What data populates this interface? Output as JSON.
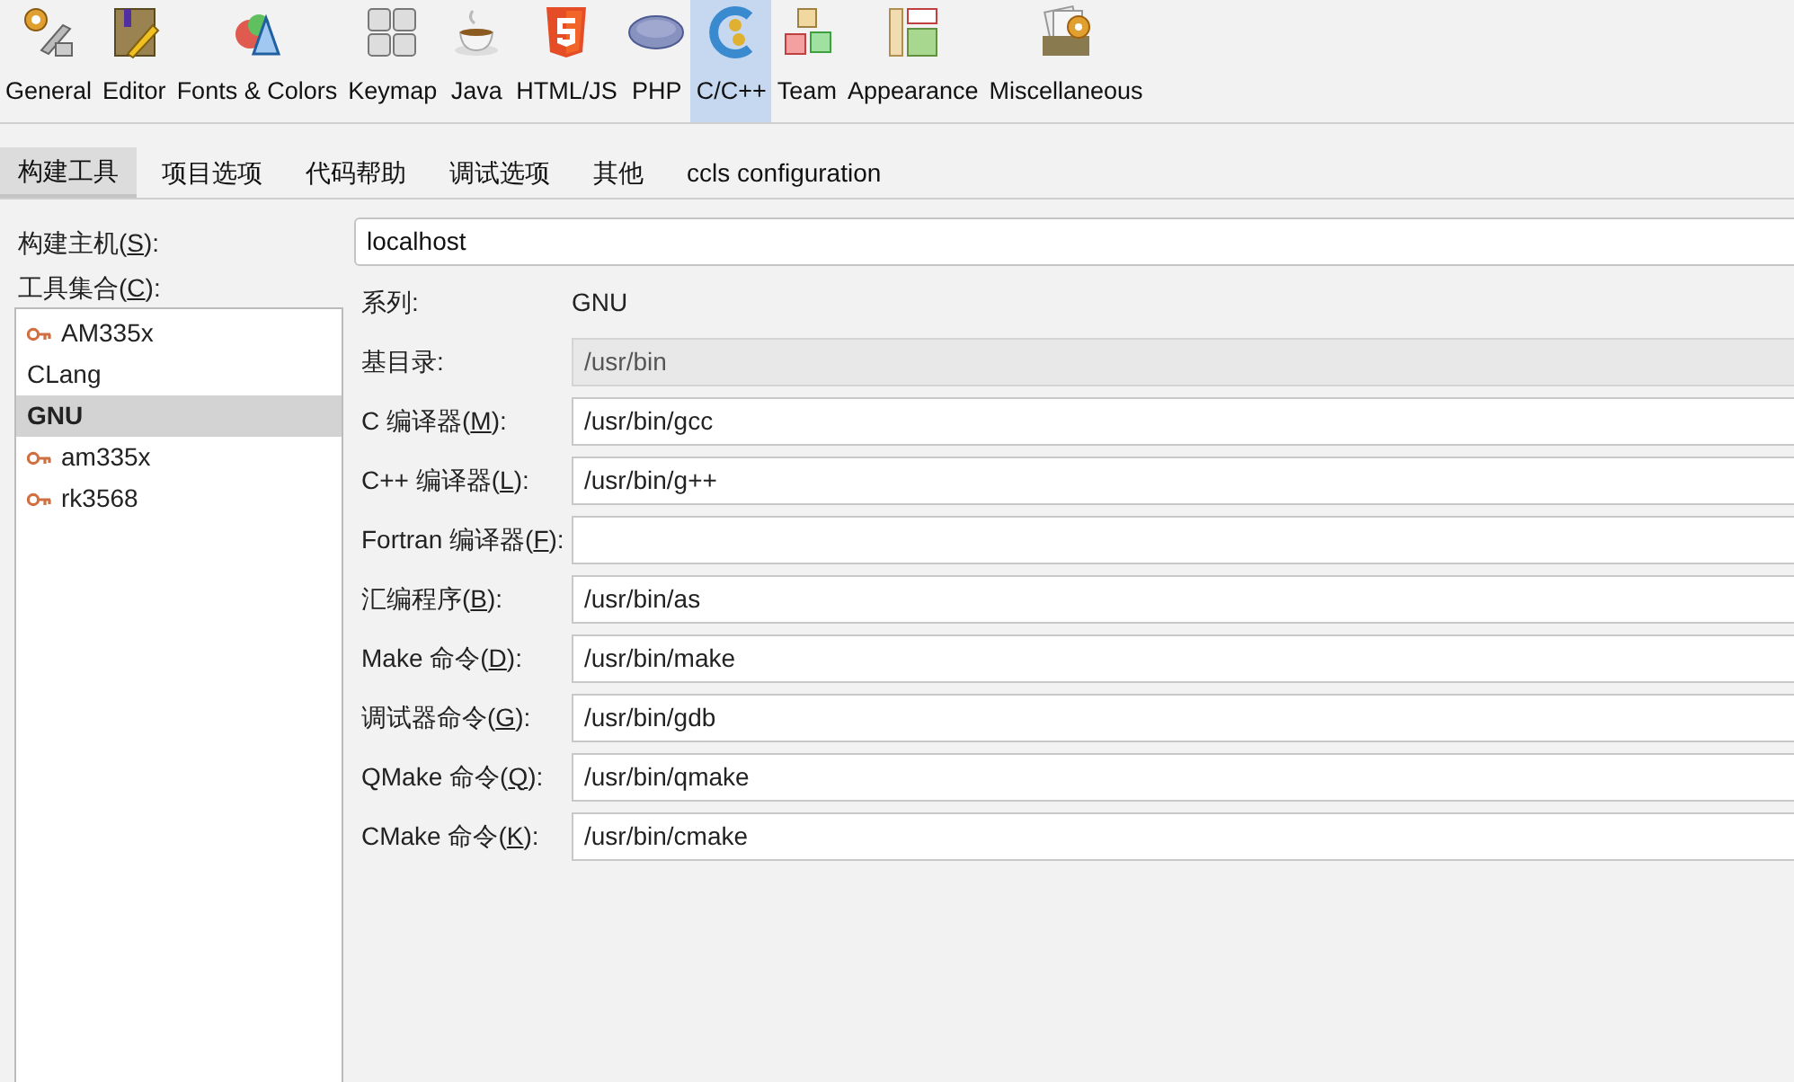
{
  "categories": [
    {
      "label": "General",
      "selected": false
    },
    {
      "label": "Editor",
      "selected": false
    },
    {
      "label": "Fonts & Colors",
      "selected": false
    },
    {
      "label": "Keymap",
      "selected": false
    },
    {
      "label": "Java",
      "selected": false
    },
    {
      "label": "HTML/JS",
      "selected": false
    },
    {
      "label": "PHP",
      "selected": false
    },
    {
      "label": "C/C++",
      "selected": true
    },
    {
      "label": "Team",
      "selected": false
    },
    {
      "label": "Appearance",
      "selected": false
    },
    {
      "label": "Miscellaneous",
      "selected": false
    }
  ],
  "tabs": [
    {
      "label": "构建工具",
      "selected": true
    },
    {
      "label": "项目选项",
      "selected": false
    },
    {
      "label": "代码帮助",
      "selected": false
    },
    {
      "label": "调试选项",
      "selected": false
    },
    {
      "label": "其他",
      "selected": false
    },
    {
      "label": "ccls configuration",
      "selected": false
    }
  ],
  "build_host": {
    "label_start": "构建主机(",
    "mnemonic": "S",
    "label_end": "):",
    "value": "localhost"
  },
  "tool_collection": {
    "label_start": "工具集合(",
    "mnemonic": "C",
    "label_end": "):",
    "items": [
      {
        "label": "AM335x",
        "remote": true,
        "selected": false
      },
      {
        "label": "CLang",
        "remote": false,
        "selected": false
      },
      {
        "label": "GNU",
        "remote": false,
        "selected": true
      },
      {
        "label": "am335x",
        "remote": true,
        "selected": false
      },
      {
        "label": "rk3568",
        "remote": true,
        "selected": false
      }
    ]
  },
  "family": {
    "label": "系列:",
    "value": "GNU"
  },
  "fields": [
    {
      "label_start": "基目录:",
      "value": "/usr/bin",
      "disabled": true
    },
    {
      "label_start": "C 编译器(",
      "mnemonic": "M",
      "label_end": "):",
      "value": "/usr/bin/gcc",
      "disabled": false
    },
    {
      "label_start": "C++ 编译器(",
      "mnemonic": "L",
      "label_end": "):",
      "value": "/usr/bin/g++",
      "disabled": false
    },
    {
      "label_start": "Fortran 编译器(",
      "mnemonic": "F",
      "label_end": "):",
      "disabled": false
    },
    {
      "label_start": "汇编程序(",
      "mnemonic": "B",
      "label_end": "):",
      "value": "/usr/bin/as",
      "disabled": false
    },
    {
      "label_start": "Make 命令(",
      "mnemonic": "D",
      "label_end": "):",
      "value": "/usr/bin/make",
      "disabled": false
    },
    {
      "label_start": "调试器命令(",
      "mnemonic": "G",
      "label_end": "):",
      "value": "/usr/bin/gdb",
      "disabled": false
    },
    {
      "label_start": "QMake 命令(",
      "mnemonic": "Q",
      "label_end": "):",
      "value": "/usr/bin/qmake",
      "disabled": false
    },
    {
      "label_start": "CMake 命令(",
      "mnemonic": "K",
      "label_end": "):",
      "value": "/usr/bin/cmake",
      "disabled": false
    }
  ]
}
